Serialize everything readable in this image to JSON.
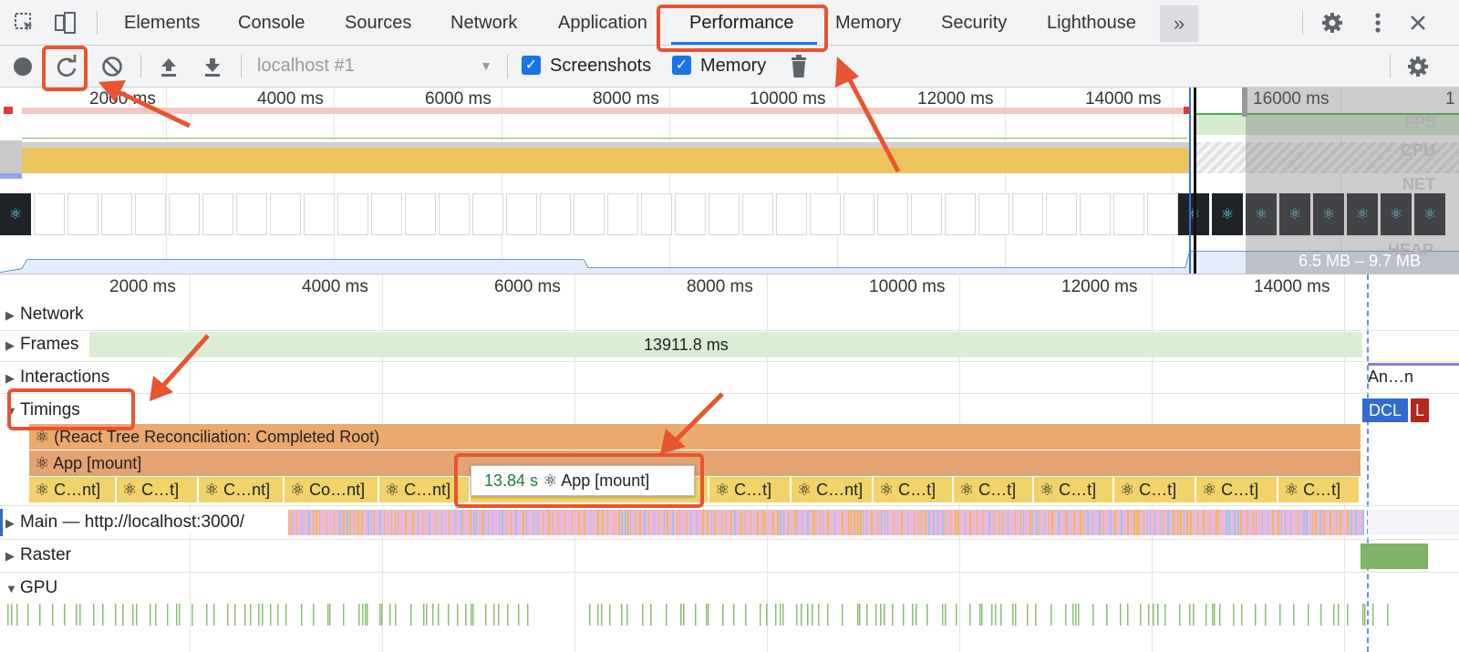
{
  "tabs": [
    "Elements",
    "Console",
    "Sources",
    "Network",
    "Application",
    "Performance",
    "Memory",
    "Security",
    "Lighthouse"
  ],
  "active_tab": "Performance",
  "more_tabs_label": "»",
  "toolbar": {
    "recording_select": "localhost #1",
    "screenshots_label": "Screenshots",
    "memory_label": "Memory",
    "screenshots_checked": true,
    "memory_checked": true
  },
  "overview": {
    "time_labels": [
      "2000 ms",
      "4000 ms",
      "6000 ms",
      "8000 ms",
      "10000 ms",
      "12000 ms",
      "14000 ms",
      "16000 ms",
      "1"
    ],
    "tracks": [
      "FPS",
      "CPU",
      "NET",
      "HEAP"
    ],
    "heap_range": "6.5 MB – 9.7 MB"
  },
  "flame": {
    "time_labels": [
      "2000 ms",
      "4000 ms",
      "6000 ms",
      "8000 ms",
      "10000 ms",
      "12000 ms",
      "14000 ms"
    ],
    "rows": {
      "network": "Network",
      "frames": "Frames",
      "interactions": "Interactions",
      "timings": "Timings",
      "main": "Main — http://localhost:3000/",
      "raster": "Raster",
      "gpu": "GPU"
    },
    "frames_duration": "13911.8 ms",
    "interaction_label": "An…n",
    "react_reconciliation": "⚛ (React Tree Reconciliation: Completed Root)",
    "app_mount": "⚛ App [mount]",
    "segments": [
      "⚛ C…nt]",
      "⚛ C…t]",
      "⚛ C…nt]",
      "⚛ Co…nt]",
      "⚛ C…nt]",
      "⚛ C…t]",
      "⚛ C…nt]",
      "⚛ C…t]",
      "⚛ C…t]",
      "⚛ C…t]",
      "⚛ C…t]",
      "⚛ C…t]",
      "⚛ C…t]"
    ],
    "markers": [
      "DCL",
      "L"
    ],
    "tooltip": {
      "duration": "13.84 s",
      "label": "⚛ App [mount]"
    }
  },
  "colors": {
    "accent": "#1a73e8",
    "annotation": "#e8542f",
    "frames": "#dcedd6",
    "timing_orange": "#eaaa6d",
    "segment_yellow": "#f2d36a",
    "cpu_scripting": "#ecc45e",
    "main_track": "#e9b7dc",
    "gpu": "#8bbd76"
  }
}
